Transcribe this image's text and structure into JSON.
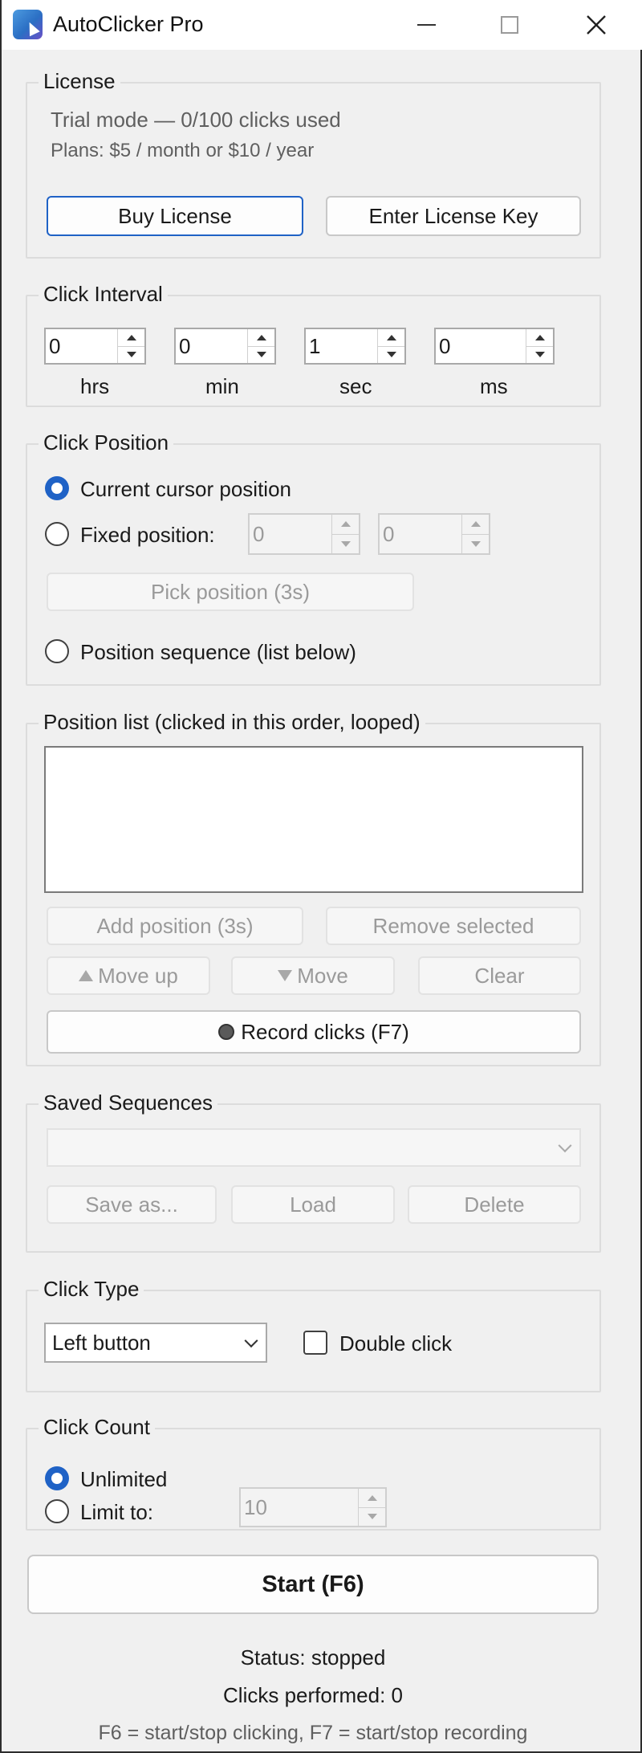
{
  "window": {
    "title": "AutoClicker Pro",
    "icons": {
      "app": "cursor-app-icon",
      "minimize": "minimize-icon",
      "maximize": "maximize-icon",
      "close": "close-icon"
    }
  },
  "license": {
    "legend": "License",
    "trial_text": "Trial mode — 0/100 clicks used",
    "plans_text": "Plans: $5 / month or $10 / year",
    "buy_label": "Buy License",
    "enter_key_label": "Enter License Key"
  },
  "interval": {
    "legend": "Click Interval",
    "fields": [
      {
        "value": "0",
        "unit": "hrs"
      },
      {
        "value": "0",
        "unit": "min"
      },
      {
        "value": "1",
        "unit": "sec"
      },
      {
        "value": "0",
        "unit": "ms"
      }
    ]
  },
  "position": {
    "legend": "Click Position",
    "current_label": "Current cursor position",
    "fixed_label": "Fixed position:",
    "fixed_x": "0",
    "fixed_y": "0",
    "pick_label": "Pick position (3s)",
    "sequence_label": "Position sequence (list below)",
    "selected": "current"
  },
  "position_list": {
    "legend": "Position list (clicked in this order, looped)",
    "items": [],
    "add_label": "Add position (3s)",
    "remove_label": "Remove selected",
    "move_up_label": "Move up",
    "move_down_label": "Move",
    "clear_label": "Clear",
    "record_label": "Record clicks (F7)"
  },
  "saved": {
    "legend": "Saved Sequences",
    "selected_value": "",
    "save_as_label": "Save as...",
    "load_label": "Load",
    "delete_label": "Delete"
  },
  "click_type": {
    "legend": "Click Type",
    "button_value": "Left button",
    "double_label": "Double click",
    "double_checked": false
  },
  "click_count": {
    "legend": "Click Count",
    "unlimited_label": "Unlimited",
    "limit_label": "Limit to:",
    "limit_value": "10",
    "selected": "unlimited"
  },
  "start_label": "Start (F6)",
  "status": {
    "state_text": "Status: stopped",
    "clicks_text": "Clicks performed: 0",
    "hotkeys_text": "F6 = start/stop clicking, F7 = start/stop recording"
  },
  "colors": {
    "accent": "#1f62c6",
    "window_bg": "#f0f0f0",
    "disabled_text": "#9a9a9a"
  }
}
